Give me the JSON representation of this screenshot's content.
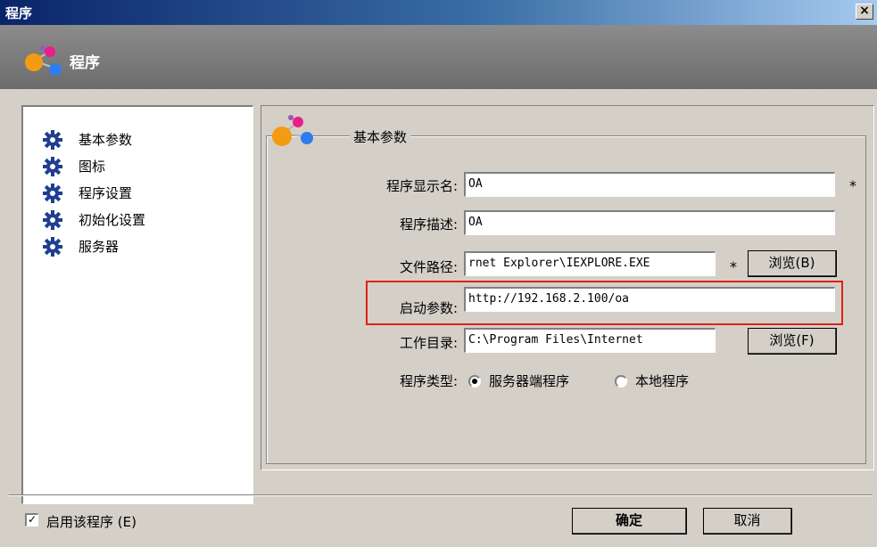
{
  "window": {
    "title": "程序",
    "close_glyph": "✕"
  },
  "header": {
    "title": "程序",
    "icon": "molecule-icon"
  },
  "sidebar": {
    "items": [
      {
        "label": "基本参数",
        "icon": "gear-icon"
      },
      {
        "label": "图标",
        "icon": "gear-icon"
      },
      {
        "label": "程序设置",
        "icon": "gear-icon"
      },
      {
        "label": "初始化设置",
        "icon": "gear-icon"
      },
      {
        "label": "服务器",
        "icon": "gear-icon"
      }
    ]
  },
  "group": {
    "title": "基本参数",
    "icon": "molecule-icon"
  },
  "form": {
    "display_name": {
      "label": "程序显示名:",
      "value": "OA",
      "required": "*"
    },
    "description": {
      "label": "程序描述:",
      "value": "OA"
    },
    "file_path": {
      "label": "文件路径:",
      "value": "rnet Explorer\\IEXPLORE.EXE",
      "required": "*",
      "browse_label": "浏览(B)"
    },
    "launch_params": {
      "label": "启动参数:",
      "value": "http://192.168.2.100/oa"
    },
    "working_dir": {
      "label": "工作目录:",
      "value": "C:\\Program Files\\Internet",
      "browse_label": "浏览(F)"
    },
    "program_type": {
      "label": "程序类型:",
      "options": [
        "服务器端程序",
        "本地程序"
      ],
      "selected": "服务器端程序"
    }
  },
  "footer": {
    "enable_label": "启用该程序 (E)",
    "enable_checked": true,
    "ok_label": "确定",
    "cancel_label": "取消"
  },
  "colors": {
    "highlight": "#e0201a",
    "titlebar": "#0a246a",
    "dialog_bg": "#d4d0c8"
  }
}
